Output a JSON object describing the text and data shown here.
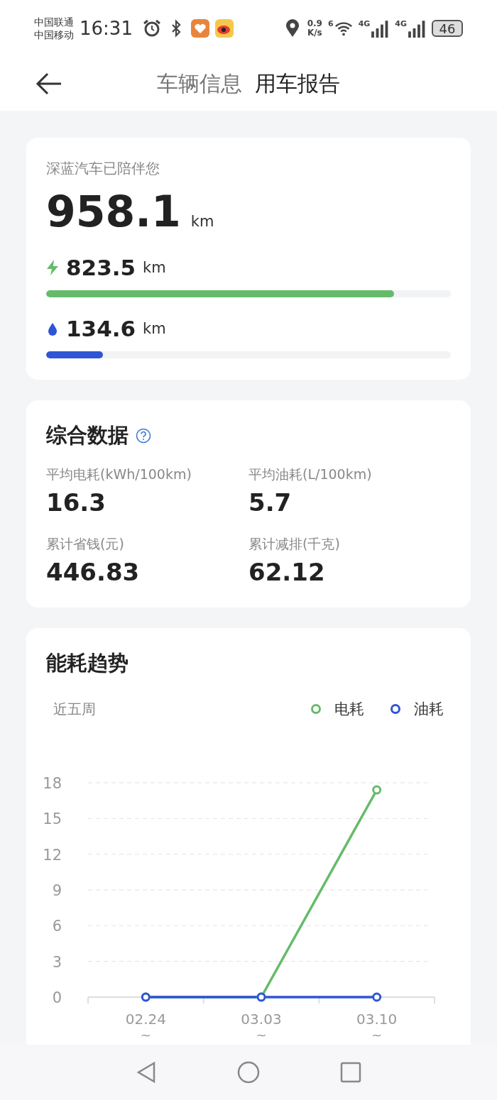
{
  "status_bar": {
    "carriers": [
      "中国联通",
      "中国移动"
    ],
    "time": "16:31",
    "net_speed": [
      "0.9",
      "K/s"
    ],
    "wifi_badge": "6",
    "signal_labels": [
      "4G",
      "4G"
    ],
    "battery": "46"
  },
  "header": {
    "tabs": [
      {
        "label": "车辆信息",
        "selected": false
      },
      {
        "label": "用车报告",
        "selected": true
      }
    ]
  },
  "mileage": {
    "caption": "深蓝汽车已陪伴您",
    "total": "958.1",
    "unit": "km",
    "items": [
      {
        "kind": "electric",
        "value": "823.5",
        "unit": "km",
        "level": 0.86,
        "color": "#66bb6a"
      },
      {
        "kind": "fuel",
        "value": "134.6",
        "unit": "km",
        "level": 0.14,
        "color": "#2f55d4"
      }
    ]
  },
  "summary": {
    "title": "综合数据",
    "stats": [
      {
        "label": "平均电耗(kWh/100km)",
        "value": "16.3"
      },
      {
        "label": "平均油耗(L/100km)",
        "value": "5.7"
      },
      {
        "label": "累计省钱(元)",
        "value": "446.83"
      },
      {
        "label": "累计减排(千克)",
        "value": "62.12"
      }
    ]
  },
  "trend": {
    "title": "能耗趋势",
    "period": "近五周",
    "range_marks": [
      "~",
      "~",
      "~"
    ],
    "chart_data": {
      "type": "line",
      "grid": true,
      "categories": [
        "02.24",
        "03.03",
        "03.10"
      ],
      "ylim": [
        0,
        18
      ],
      "yticks": [
        0,
        3,
        6,
        9,
        12,
        15,
        18
      ],
      "series": [
        {
          "name": "电耗",
          "color": "#66bb6a",
          "marker": "circle",
          "values": [
            0,
            0,
            17.4
          ]
        },
        {
          "name": "油耗",
          "color": "#2f55d4",
          "marker": "circle",
          "values": [
            0,
            0,
            0
          ]
        }
      ]
    }
  }
}
